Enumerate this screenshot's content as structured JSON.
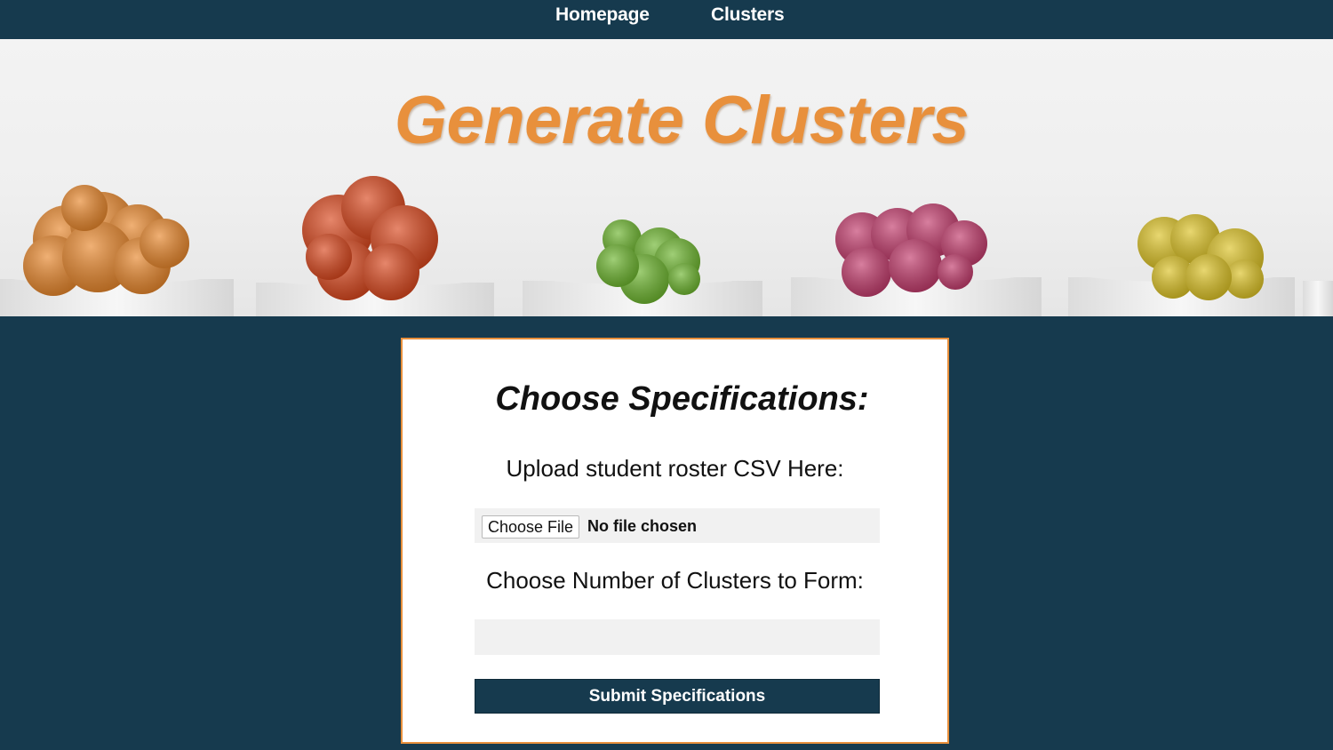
{
  "nav": {
    "links": [
      {
        "label": "Homepage"
      },
      {
        "label": "Clusters"
      }
    ]
  },
  "hero": {
    "title": "Generate Clusters",
    "cactus_colors": [
      "#e8862a",
      "#d9461c",
      "#6cb52d",
      "#c23a6b",
      "#dcc224"
    ]
  },
  "form": {
    "title": "Choose Specifications:",
    "upload_label": "Upload student roster CSV Here:",
    "file_button_label": "Choose File",
    "file_status": "No file chosen",
    "clusters_label": "Choose Number of Clusters to Form:",
    "clusters_value": "",
    "submit_label": "Submit Specifications"
  },
  "colors": {
    "nav_bg": "#163a4e",
    "accent": "#e8903c",
    "input_bg": "#f1f1f1"
  }
}
